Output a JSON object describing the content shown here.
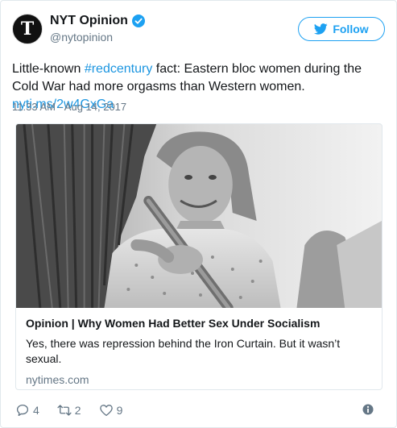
{
  "author": {
    "display_name": "NYT Opinion",
    "handle": "@nytopinion",
    "avatar_glyph": "T",
    "verified": true
  },
  "follow_button": {
    "label": "Follow",
    "icon": "twitter-bird-icon",
    "color": "#1da1f2"
  },
  "tweet": {
    "text_before": "Little-known ",
    "hashtag": "#redcentury",
    "text_after": " fact: Eastern bloc women during the Cold War had more orgasms than Western women. ",
    "link": "nyti.ms/2w4GxGa",
    "timestamp": "11:33 AM - Aug 14, 2017",
    "link_color": "#1b95e0"
  },
  "card": {
    "image_icon": "photo-woman-with-hay-pitchfork",
    "title": "Opinion | Why Women Had Better Sex Under Socialism",
    "description": "Yes, there was repression behind the Iron Curtain. But it wasn’t sexual.",
    "domain": "nytimes.com"
  },
  "actions": {
    "reply_count": "4",
    "retweet_count": "2",
    "like_count": "9"
  }
}
